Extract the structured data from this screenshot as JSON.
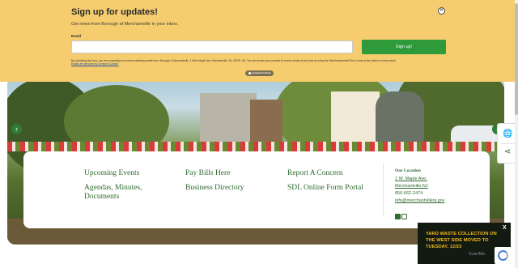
{
  "signup": {
    "title": "Sign up for updates!",
    "subtitle": "Get news from Borough of Merchantville in your inbox.",
    "email_label": "Email",
    "email_value": "",
    "button": "Sign up!",
    "legal_text": "By submitting this form, you are consenting to receive marketing emails from: Borough of Merchantville, 1 West Maple Ave, Merchantville, NJ, 08109, US. You can revoke your consent to receive emails at any time by using the SafeUnsubscribe® link, found at the bottom of every email.",
    "legal_link": "Emails are serviced by Constant Contact.",
    "badge": "Constant Contact",
    "close_icon": "close-icon"
  },
  "quick_links": {
    "col1": [
      "Upcoming Events",
      "Agendas, Minutes, Documents"
    ],
    "col2": [
      "Pay Bills Here",
      "Business Directory"
    ],
    "col3": [
      "Report A Concern",
      "SDL Online Form Portal"
    ]
  },
  "location": {
    "heading": "Our Location",
    "address1": "1 W. Maple Ave,",
    "address2": "Merchantville,NJ",
    "phone": "856-662-2474",
    "email": "info@merchantvillenj.gov",
    "social_icons": [
      "facebook-icon",
      "instagram-icon"
    ]
  },
  "side_widget": {
    "icons": [
      "globe-icon",
      "share-icon"
    ]
  },
  "hero": {
    "prev_icon": "chevron-left-icon",
    "next_icon": "chevron-right-icon"
  },
  "alert": {
    "text": "YARD WASTE COLLECTION ON THE WEST SIDE MOVED TO TUESDAY, 12/23",
    "close": "X"
  },
  "scanme": "ScanMe",
  "colors": {
    "accent": "#2f6a2f",
    "banner": "#f6cd6e",
    "button": "#2e9a3a",
    "alert_text": "#f0b81a"
  }
}
